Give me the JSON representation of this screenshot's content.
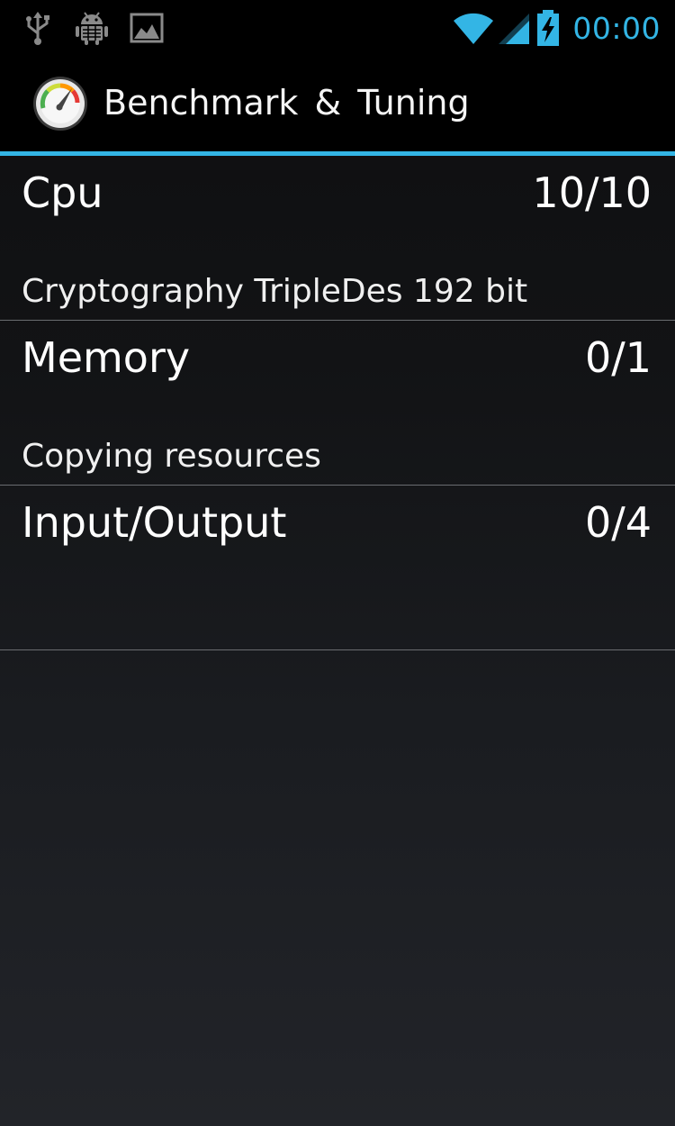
{
  "status_bar": {
    "left_icons": [
      "usb-icon",
      "android-debug-icon",
      "image-notification-icon"
    ],
    "right_icons": [
      "wifi-icon",
      "cell-signal-icon",
      "battery-charging-icon"
    ],
    "time": "00:00",
    "accent_color": "#33b5e5"
  },
  "action_bar": {
    "app_icon": "speedometer-icon",
    "title": "Benchmark & Tuning",
    "accent_color": "#33b5e5"
  },
  "benchmarks": [
    {
      "label": "Cpu",
      "score": "10/10",
      "status": "Cryptography TripleDes 192 bit"
    },
    {
      "label": "Memory",
      "score": "0/1",
      "status": "Copying resources"
    },
    {
      "label": "Input/Output",
      "score": "0/4",
      "status": ""
    }
  ]
}
